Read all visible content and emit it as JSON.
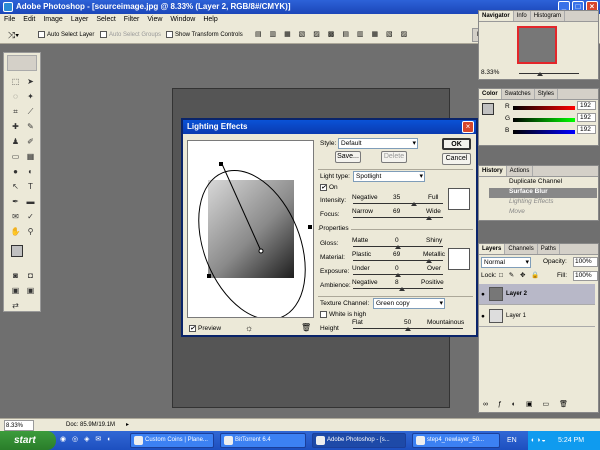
{
  "window": {
    "title": "Adobe Photoshop - [sourceimage.jpg @ 8.33% (Layer 2, RGB/8#/CMYK)]",
    "min": "_",
    "max": "□",
    "close": "×"
  },
  "menu": [
    "File",
    "Edit",
    "Image",
    "Layer",
    "Select",
    "Filter",
    "View",
    "Window",
    "Help"
  ],
  "options": {
    "auto_select_layer": "Auto Select Layer",
    "auto_select_groups": "Auto Select Groups",
    "show_transform": "Show Transform Controls"
  },
  "status": {
    "zoom": "8.33%",
    "doc": "Doc: 85.9M/19.1M"
  },
  "taskbar": {
    "start": "start",
    "items": [
      "Custom Coins | Plane...",
      "BitTorrent 6.4",
      "Adobe Photoshop - [s...",
      "step4_newlayer_50..."
    ],
    "lang": "EN",
    "time": "5:24 PM"
  },
  "navigator": {
    "tabs": [
      "Navigator",
      "Info",
      "Histogram"
    ],
    "zoom": "8.33%"
  },
  "color": {
    "tabs": [
      "Color",
      "Swatches",
      "Styles"
    ],
    "r_label": "R",
    "g_label": "G",
    "b_label": "B",
    "r": "192",
    "g": "192",
    "b": "192"
  },
  "history": {
    "tabs": [
      "History",
      "Actions"
    ],
    "items": [
      "Duplicate Channel",
      "Surface Blur",
      "Lighting Effects",
      "Move"
    ]
  },
  "layers": {
    "tabs": [
      "Layers",
      "Channels",
      "Paths"
    ],
    "mode": "Normal",
    "opacity_label": "Opacity:",
    "opacity": "100%",
    "lock_label": "Lock:",
    "fill_label": "Fill:",
    "fill": "100%",
    "items": [
      "Layer 2",
      "Layer 1"
    ]
  },
  "dialog": {
    "title": "Lighting Effects",
    "style_label": "Style:",
    "style": "Default",
    "save": "Save...",
    "delete": "Delete",
    "ok": "OK",
    "cancel": "Cancel",
    "light_type_label": "Light type:",
    "light_type": "Spotlight",
    "on_label": "On",
    "intensity": {
      "label": "Intensity:",
      "min": "Negative",
      "value": "35",
      "max": "Full",
      "level": 0.675
    },
    "focus": {
      "label": "Focus:",
      "min": "Narrow",
      "value": "69",
      "max": "Wide",
      "level": 0.845
    },
    "properties_label": "Properties",
    "gloss": {
      "label": "Gloss:",
      "min": "Matte",
      "value": "0",
      "max": "Shiny",
      "level": 0.5
    },
    "material": {
      "label": "Material:",
      "min": "Plastic",
      "value": "69",
      "max": "Metallic",
      "level": 0.845
    },
    "exposure": {
      "label": "Exposure:",
      "min": "Under",
      "value": "0",
      "max": "Over",
      "level": 0.5
    },
    "ambience": {
      "label": "Ambience:",
      "min": "Negative",
      "value": "8",
      "max": "Positive",
      "level": 0.54
    },
    "texture_label": "Texture Channel:",
    "texture": "Green copy",
    "white_is_high": "White is high",
    "height": {
      "label": "Height",
      "min": "Flat",
      "value": "50",
      "max": "Mountainous",
      "level": 0.5
    },
    "preview_label": "Preview"
  }
}
